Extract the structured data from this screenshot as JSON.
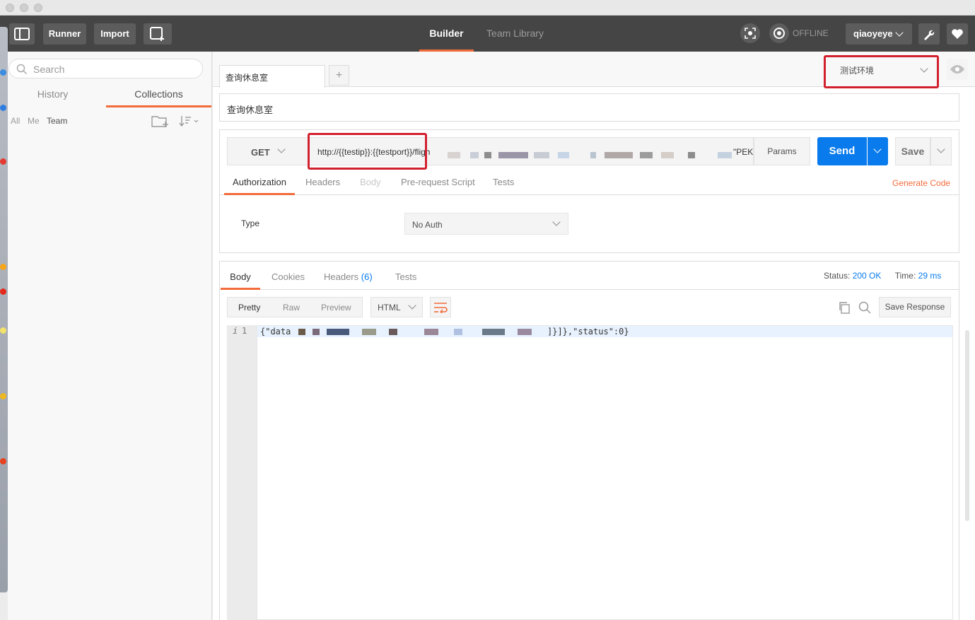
{
  "header": {
    "runner_label": "Runner",
    "import_label": "Import",
    "tabs": [
      {
        "label": "Builder"
      },
      {
        "label": "Team Library"
      }
    ],
    "offline_label": "OFFLINE",
    "user": "qiaoyeye"
  },
  "sidebar": {
    "search_placeholder": "Search",
    "tabs": [
      {
        "label": "History"
      },
      {
        "label": "Collections"
      }
    ],
    "filters": [
      {
        "label": "All"
      },
      {
        "label": "Me"
      },
      {
        "label": "Team"
      }
    ]
  },
  "builder": {
    "request_tab": "查询休息室",
    "new_tab_label": "+",
    "environment": "测试环境",
    "request_name": "查询休息室",
    "method": "GET",
    "url": "http://{{testip}}:{{testport}}/fligh",
    "url_tail": "\"PEK\"",
    "params_label": "Params",
    "send_label": "Send",
    "save_label": "Save",
    "request_tabs": [
      {
        "label": "Authorization"
      },
      {
        "label": "Headers"
      },
      {
        "label": "Body"
      },
      {
        "label": "Pre-request Script"
      },
      {
        "label": "Tests"
      }
    ],
    "generate_code_label": "Generate Code",
    "auth": {
      "type_label": "Type",
      "type_value": "No Auth"
    }
  },
  "response": {
    "tabs": [
      {
        "label": "Body"
      },
      {
        "label": "Cookies"
      },
      {
        "label": "Headers"
      },
      {
        "label": "Tests"
      }
    ],
    "headers_count": "(6)",
    "status_label": "Status:",
    "status_value": "200 OK",
    "time_label": "Time:",
    "time_value": "29 ms",
    "view_modes": [
      {
        "label": "Pretty"
      },
      {
        "label": "Raw"
      },
      {
        "label": "Preview"
      }
    ],
    "format": "HTML",
    "save_response_label": "Save Response",
    "line_marker": "i",
    "line_number": "1",
    "code_start": "{\"data",
    "code_end": "]}]},\"status\":0}"
  },
  "colors": {
    "accent_orange": "#f26b3a",
    "send_blue": "#097bed",
    "highlight_red": "#d2202f",
    "header_dark": "#454545"
  }
}
